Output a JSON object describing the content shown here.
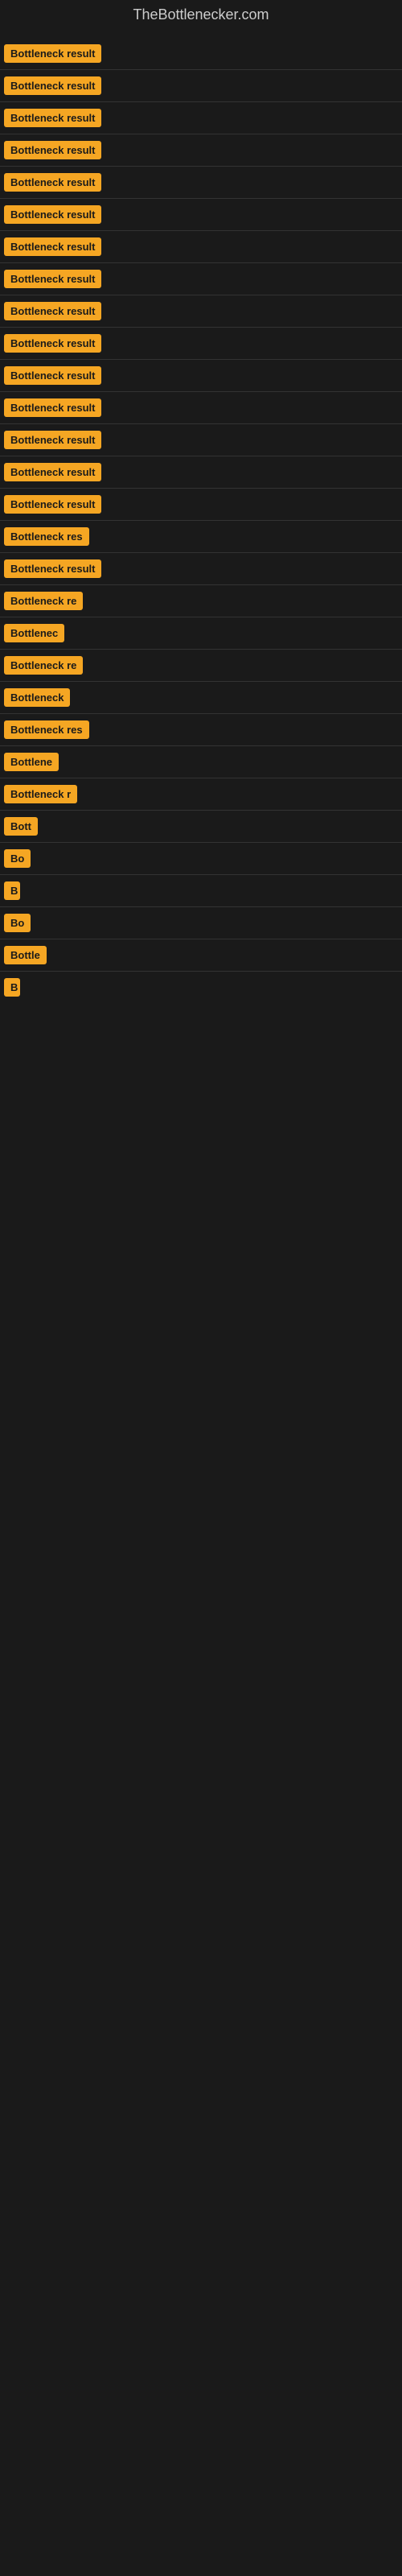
{
  "site": {
    "title": "TheBottlenecker.com"
  },
  "items": [
    {
      "id": 1,
      "label": "Bottleneck result",
      "widthClass": "w-full"
    },
    {
      "id": 2,
      "label": "Bottleneck result",
      "widthClass": "w-full"
    },
    {
      "id": 3,
      "label": "Bottleneck result",
      "widthClass": "w-full"
    },
    {
      "id": 4,
      "label": "Bottleneck result",
      "widthClass": "w-full"
    },
    {
      "id": 5,
      "label": "Bottleneck result",
      "widthClass": "w-full"
    },
    {
      "id": 6,
      "label": "Bottleneck result",
      "widthClass": "w-full"
    },
    {
      "id": 7,
      "label": "Bottleneck result",
      "widthClass": "w-full"
    },
    {
      "id": 8,
      "label": "Bottleneck result",
      "widthClass": "w-full"
    },
    {
      "id": 9,
      "label": "Bottleneck result",
      "widthClass": "w-full"
    },
    {
      "id": 10,
      "label": "Bottleneck result",
      "widthClass": "w-full"
    },
    {
      "id": 11,
      "label": "Bottleneck result",
      "widthClass": "w-full"
    },
    {
      "id": 12,
      "label": "Bottleneck result",
      "widthClass": "w-full"
    },
    {
      "id": 13,
      "label": "Bottleneck result",
      "widthClass": "w-full"
    },
    {
      "id": 14,
      "label": "Bottleneck result",
      "widthClass": "w-full"
    },
    {
      "id": 15,
      "label": "Bottleneck result",
      "widthClass": "w-full"
    },
    {
      "id": 16,
      "label": "Bottleneck res",
      "widthClass": "w-large"
    },
    {
      "id": 17,
      "label": "Bottleneck result",
      "widthClass": "w-full"
    },
    {
      "id": 18,
      "label": "Bottleneck re",
      "widthClass": "w-med"
    },
    {
      "id": 19,
      "label": "Bottlenec",
      "widthClass": "w-small"
    },
    {
      "id": 20,
      "label": "Bottleneck re",
      "widthClass": "w-med"
    },
    {
      "id": 21,
      "label": "Bottleneck",
      "widthClass": "w-small"
    },
    {
      "id": 22,
      "label": "Bottleneck res",
      "widthClass": "w-large"
    },
    {
      "id": 23,
      "label": "Bottlene",
      "widthClass": "w-small"
    },
    {
      "id": 24,
      "label": "Bottleneck r",
      "widthClass": "w-med"
    },
    {
      "id": 25,
      "label": "Bott",
      "widthClass": "w-xsmall"
    },
    {
      "id": 26,
      "label": "Bo",
      "widthClass": "w-tiny"
    },
    {
      "id": 27,
      "label": "B",
      "widthClass": "w-micro"
    },
    {
      "id": 28,
      "label": "Bo",
      "widthClass": "w-tiny"
    },
    {
      "id": 29,
      "label": "Bottle",
      "widthClass": "w-xsmall"
    },
    {
      "id": 30,
      "label": "B",
      "widthClass": "w-micro"
    }
  ]
}
